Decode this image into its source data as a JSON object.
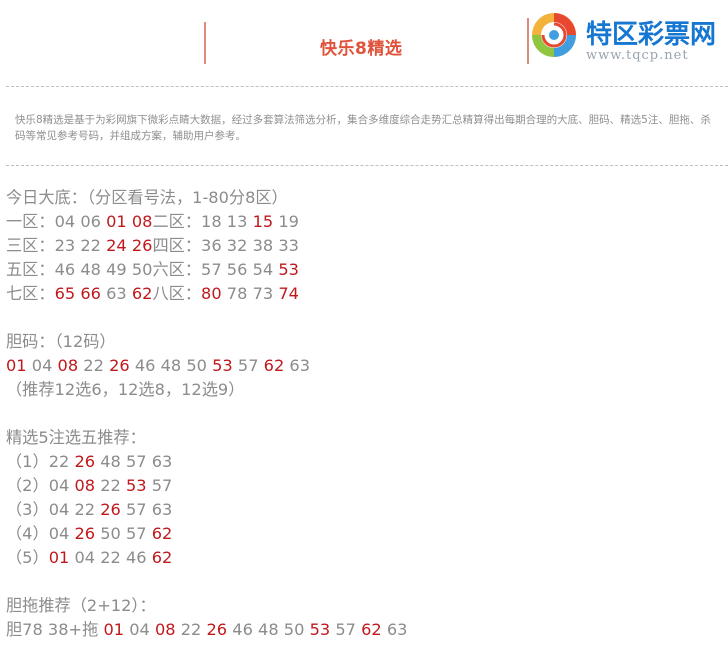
{
  "header": {
    "title": "快乐8精选",
    "logo_text": "特区彩票网",
    "logo_url": "www.tqcp.net"
  },
  "intro": "快乐8精选是基于为彩网旗下微彩点睛大数据，经过多套算法筛选分析，集合多维度综合走势汇总精算得出每期合理的大底、胆码、精选5注、胆拖、杀码等常见参考号码，并组成方案，辅助用户参考。",
  "colors": {
    "red": "#c0191c",
    "gray": "#8c8c8c",
    "title": "#e0533b",
    "logo_blue": "#1677d2"
  },
  "dadi": {
    "heading": "今日大底：（分区看号法，1-80分8区）",
    "zones": [
      {
        "label": "一区：",
        "nums": [
          {
            "v": "04",
            "r": false
          },
          {
            "v": "06",
            "r": false
          },
          {
            "v": "01",
            "r": true
          },
          {
            "v": "08",
            "r": true
          }
        ]
      },
      {
        "label": "二区：",
        "nums": [
          {
            "v": "18",
            "r": false
          },
          {
            "v": "13",
            "r": false
          },
          {
            "v": "15",
            "r": true
          },
          {
            "v": "19",
            "r": false
          }
        ]
      },
      {
        "label": "三区：",
        "nums": [
          {
            "v": "23",
            "r": false
          },
          {
            "v": "22",
            "r": false
          },
          {
            "v": "24",
            "r": true
          },
          {
            "v": "26",
            "r": true
          }
        ]
      },
      {
        "label": "四区：",
        "nums": [
          {
            "v": "36",
            "r": false
          },
          {
            "v": "32",
            "r": false
          },
          {
            "v": "38",
            "r": false
          },
          {
            "v": "33",
            "r": false
          }
        ]
      },
      {
        "label": "五区：",
        "nums": [
          {
            "v": "46",
            "r": false
          },
          {
            "v": "48",
            "r": false
          },
          {
            "v": "49",
            "r": false
          },
          {
            "v": "50",
            "r": false
          }
        ]
      },
      {
        "label": "六区：",
        "nums": [
          {
            "v": "57",
            "r": false
          },
          {
            "v": "56",
            "r": false
          },
          {
            "v": "54",
            "r": false
          },
          {
            "v": "53",
            "r": true
          }
        ]
      },
      {
        "label": "七区：",
        "nums": [
          {
            "v": "65",
            "r": true
          },
          {
            "v": "66",
            "r": true
          },
          {
            "v": "63",
            "r": false
          },
          {
            "v": "62",
            "r": true
          }
        ]
      },
      {
        "label": "八区：",
        "nums": [
          {
            "v": "80",
            "r": true
          },
          {
            "v": "78",
            "r": false
          },
          {
            "v": "73",
            "r": false
          },
          {
            "v": "74",
            "r": true
          }
        ]
      }
    ]
  },
  "danma": {
    "heading": "胆码：（12码）",
    "nums": [
      {
        "v": "01",
        "r": true
      },
      {
        "v": "04",
        "r": false
      },
      {
        "v": "08",
        "r": true
      },
      {
        "v": "22",
        "r": false
      },
      {
        "v": "26",
        "r": true
      },
      {
        "v": "46",
        "r": false
      },
      {
        "v": "48",
        "r": false
      },
      {
        "v": "50",
        "r": false
      },
      {
        "v": "53",
        "r": true
      },
      {
        "v": "57",
        "r": false
      },
      {
        "v": "62",
        "r": true
      },
      {
        "v": "63",
        "r": false
      }
    ],
    "note": "（推荐12选6，12选8，12选9）"
  },
  "jingxuan": {
    "heading": "精选5注选五推荐：",
    "rows": [
      {
        "label": "（1）",
        "nums": [
          {
            "v": "22",
            "r": false
          },
          {
            "v": "26",
            "r": true
          },
          {
            "v": "48",
            "r": false
          },
          {
            "v": "57",
            "r": false
          },
          {
            "v": "63",
            "r": false
          }
        ]
      },
      {
        "label": "（2）",
        "nums": [
          {
            "v": "04",
            "r": false
          },
          {
            "v": "08",
            "r": true
          },
          {
            "v": "22",
            "r": false
          },
          {
            "v": "53",
            "r": true
          },
          {
            "v": "57",
            "r": false
          }
        ]
      },
      {
        "label": "（3）",
        "nums": [
          {
            "v": "04",
            "r": false
          },
          {
            "v": "22",
            "r": false
          },
          {
            "v": "26",
            "r": true
          },
          {
            "v": "57",
            "r": false
          },
          {
            "v": "63",
            "r": false
          }
        ]
      },
      {
        "label": "（4）",
        "nums": [
          {
            "v": "04",
            "r": false
          },
          {
            "v": "26",
            "r": true
          },
          {
            "v": "50",
            "r": false
          },
          {
            "v": "57",
            "r": false
          },
          {
            "v": "62",
            "r": true
          }
        ]
      },
      {
        "label": "（5）",
        "nums": [
          {
            "v": "01",
            "r": true
          },
          {
            "v": "04",
            "r": false
          },
          {
            "v": "22",
            "r": false
          },
          {
            "v": "46",
            "r": false
          },
          {
            "v": "62",
            "r": true
          }
        ]
      }
    ]
  },
  "dantuo": {
    "heading": "胆拖推荐（2+12）：",
    "dan_label": "胆78 38+拖",
    "nums": [
      {
        "v": "01",
        "r": true
      },
      {
        "v": "04",
        "r": false
      },
      {
        "v": "08",
        "r": true
      },
      {
        "v": "22",
        "r": false
      },
      {
        "v": "26",
        "r": true
      },
      {
        "v": "46",
        "r": false
      },
      {
        "v": "48",
        "r": false
      },
      {
        "v": "50",
        "r": false
      },
      {
        "v": "53",
        "r": true
      },
      {
        "v": "57",
        "r": false
      },
      {
        "v": "62",
        "r": true
      },
      {
        "v": "63",
        "r": false
      }
    ]
  }
}
